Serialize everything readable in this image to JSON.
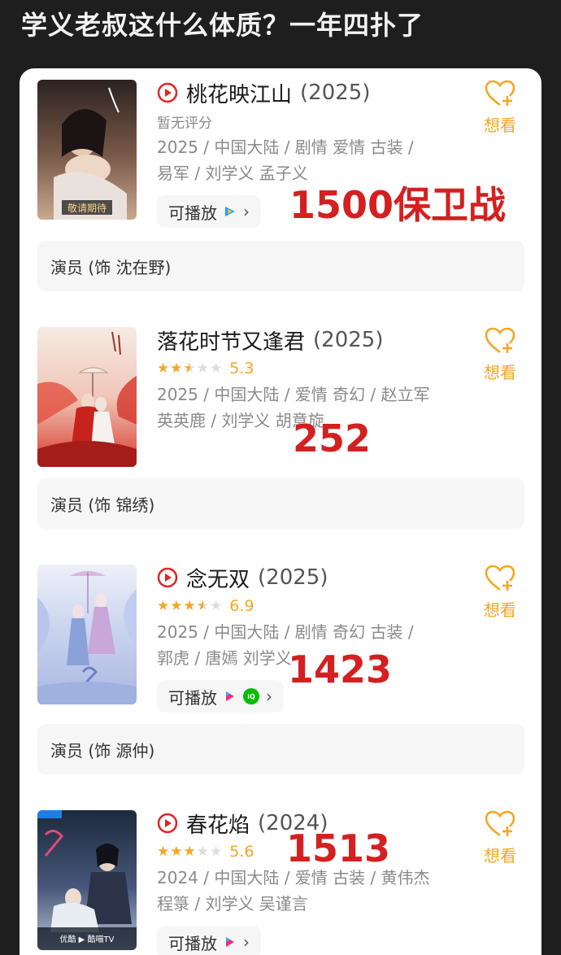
{
  "post_title": "学义老叔这什么体质？一年四扑了",
  "want_label": "想看",
  "playable_label": "可播放",
  "movies": [
    {
      "title": "桃花映江山",
      "year": "(2025)",
      "has_play_icon": true,
      "rating_text": "暂无评分",
      "meta_line1": "2025 / 中国大陆 / 剧情 爱情 古装 /",
      "meta_line2": "易军 / 刘学义 孟子义",
      "cast_text": "演员 (饰 沈在野)",
      "annotation": "1500保卫战",
      "poster_text": "敬请期待",
      "poster_colors": [
        "#3b2a26",
        "#7a5a4a",
        "#c9a98e"
      ]
    },
    {
      "title": "落花时节又逢君",
      "year": "(2025)",
      "has_play_icon": false,
      "rating": 2.5,
      "score": "5.3",
      "meta_line1": "2025 / 中国大陆 / 爱情 奇幻 / 赵立军",
      "meta_line2": "英英鹿 / 刘学义 胡意旋",
      "cast_text": "演员 (饰 锦绣)",
      "annotation": "252",
      "poster_colors": [
        "#f3e4dc",
        "#d83a2c",
        "#8a1f1a"
      ]
    },
    {
      "title": "念无双",
      "year": "(2025)",
      "has_play_icon": true,
      "rating": 3.5,
      "score": "6.9",
      "meta_line1": "2025 / 中国大陆 / 剧情 奇幻 古装 /",
      "meta_line2": "郭虎 / 唐嫣 刘学义",
      "cast_text": "演员 (饰 源仲)",
      "annotation": "1423",
      "poster_colors": [
        "#e6e9f5",
        "#a9b6e0",
        "#c8a7d6"
      ]
    },
    {
      "title": "春花焰",
      "year": "(2024)",
      "has_play_icon": true,
      "rating": 3,
      "score": "5.6",
      "meta_line1": "2024 / 中国大陆 / 爱情 古装 / 黄伟杰",
      "meta_line2": "程箓 / 刘学义 吴谨言",
      "cast_text": "",
      "annotation": "1513",
      "poster_text": "优酷 ▶ 酷喵TV",
      "poster_colors": [
        "#1c2a3c",
        "#46577a",
        "#b7c3d6"
      ]
    }
  ],
  "colors": {
    "accent": "#f5a623",
    "play_red": "#e02424",
    "annotation_red": "#d42020"
  }
}
